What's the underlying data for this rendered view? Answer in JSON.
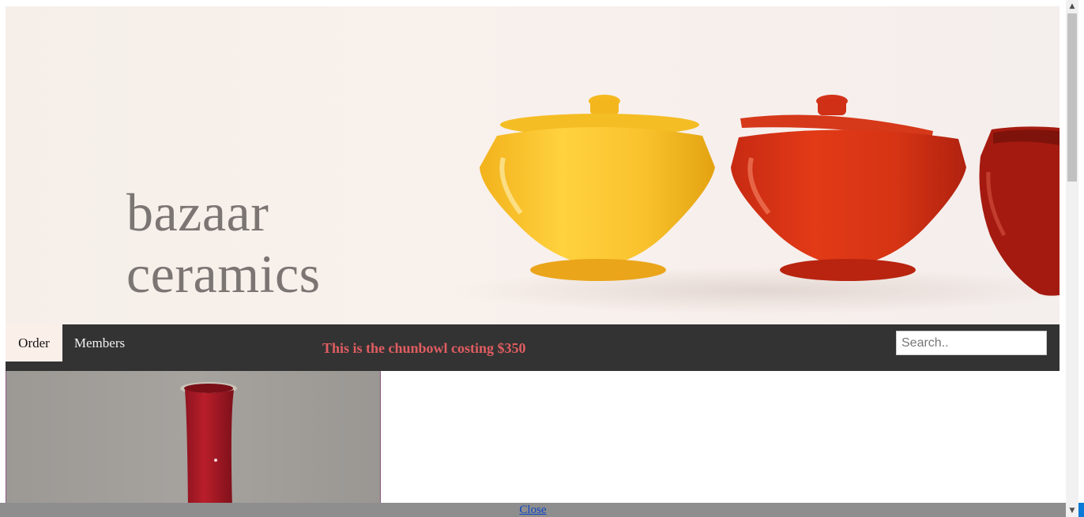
{
  "banner": {
    "brand_line1": "bazaar",
    "brand_line2": "ceramics",
    "pots": [
      "yellow-lidded-pot",
      "red-lidded-pot",
      "dark-red-pot"
    ]
  },
  "nav": {
    "order_label": "Order",
    "members_label": "Members",
    "promo_text": "This is the chunbowl costing $350",
    "search_placeholder": "Search.."
  },
  "product": {
    "image": "red-vase-image"
  },
  "footer": {
    "close_label": "Close"
  },
  "scrollbar": {
    "up_icon": "chevron-up-icon",
    "down_icon": "chevron-down-icon"
  },
  "colors": {
    "nav_bg": "#333333",
    "nav_active_bg": "#fbefe9",
    "promo": "#e05d61",
    "yellow_pot": "#f7c02b",
    "red_pot": "#d93414",
    "dark_red_pot": "#a51a10",
    "vase": "#b21a26"
  }
}
